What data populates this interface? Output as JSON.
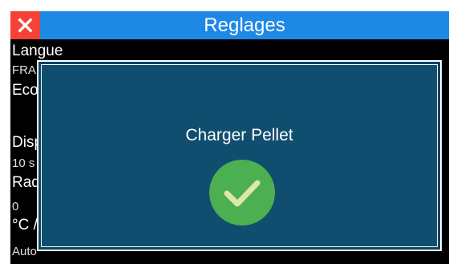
{
  "header": {
    "title": "Reglages",
    "close_icon": "close-icon"
  },
  "settings": {
    "rows": [
      {
        "label": "Langue",
        "value": "FRA"
      },
      {
        "label": "Eco",
        "value": ""
      },
      {
        "label": "Disp",
        "value": "10 s"
      },
      {
        "label": "Rad",
        "value": "0"
      },
      {
        "label": "°C /",
        "value": "Auto"
      }
    ]
  },
  "modal": {
    "message": "Charger Pellet",
    "status_icon": "check-circle-icon"
  },
  "colors": {
    "titlebar": "#1e88e5",
    "close_button": "#f44336",
    "modal_background": "#104e6f",
    "success": "#4caf50"
  }
}
